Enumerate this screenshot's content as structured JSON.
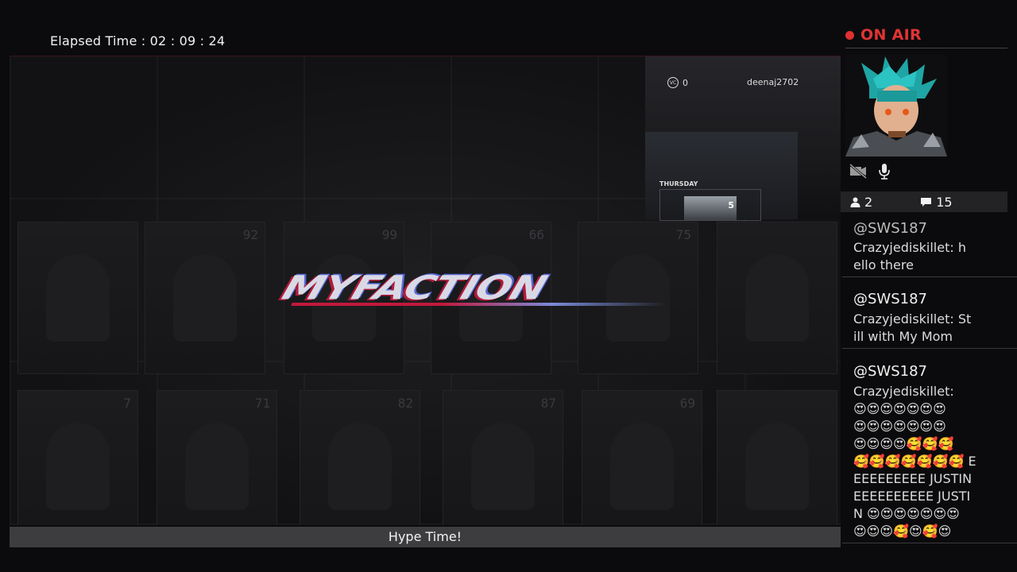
{
  "elapsed": {
    "label": "Elapsed Time :",
    "value": "02 : 09 : 24"
  },
  "game": {
    "logo_text": "MYFACTION",
    "card_numbers": [
      "92",
      "99",
      "66",
      "75",
      "7",
      "71",
      "82",
      "87",
      "69"
    ],
    "overlay": {
      "vc_label": "VC",
      "vc_value": "0",
      "username": "deenaj2702",
      "day": "THURSDAY",
      "mini_card_number": "5"
    },
    "bottom_bar": "Hype Time!"
  },
  "stream": {
    "status": "ON AIR",
    "status_color": "#e03434",
    "camera_icon": "camera-off-icon",
    "mic_icon": "microphone-icon",
    "viewers": "2",
    "comments": "15"
  },
  "chat": [
    {
      "user": "@SWS187",
      "text": "Crazyjediskillet: hello there"
    },
    {
      "user": "@SWS187",
      "text": "Crazyjediskillet: Still with My Mom"
    },
    {
      "user": "@SWS187",
      "text_lines": [
        "Crazyjediskillet:",
        "😍😍😍😍😍😍😍",
        "😍😍😍😍😍😍😍",
        "😍😍😍😍🥰🥰🥰",
        "🥰🥰🥰🥰🥰🥰🥰 E",
        "EEEEEEEEE JUSTIN",
        "EEEEEEEEEE JUSTI",
        "N 😍😍😍😍😍😍😍",
        "😍😍😍🥰😍🥰😍"
      ]
    }
  ]
}
